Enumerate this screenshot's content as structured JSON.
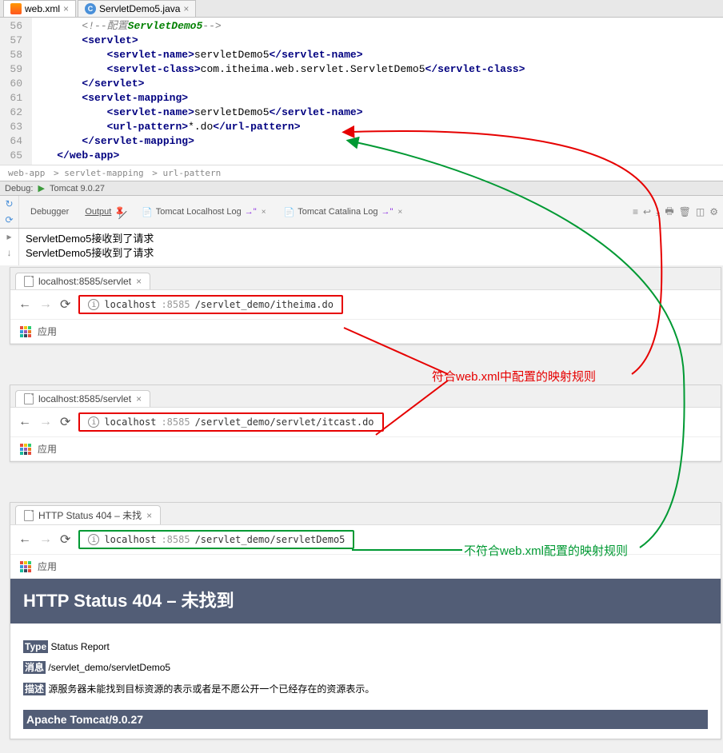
{
  "ide": {
    "tabs": [
      {
        "label": "web.xml",
        "active": true,
        "type": "xml"
      },
      {
        "label": "ServletDemo5.java",
        "active": false,
        "type": "java"
      }
    ],
    "lines": [
      "56",
      "57",
      "58",
      "59",
      "60",
      "61",
      "62",
      "63",
      "64",
      "65"
    ],
    "code": {
      "l56": {
        "indent": "        ",
        "open": "<!--",
        "body": "配置",
        "ital": "ServletDemo5",
        "close": "-->"
      },
      "l57": {
        "indent": "        ",
        "t1": "<",
        "t2": "servlet",
        "t3": ">"
      },
      "l58": {
        "indent": "            ",
        "t1": "<",
        "t2": "servlet-name",
        "t3": ">",
        "txt": "servletDemo5",
        "t4": "</",
        "t5": "servlet-name",
        "t6": ">"
      },
      "l59": {
        "indent": "            ",
        "t1": "<",
        "t2": "servlet-class",
        "t3": ">",
        "txt": "com.itheima.web.servlet.ServletDemo5",
        "t4": "</",
        "t5": "servlet-class",
        "t6": ">"
      },
      "l60": {
        "indent": "        ",
        "t1": "</",
        "t2": "servlet",
        "t3": ">"
      },
      "l61": {
        "indent": "        ",
        "t1": "<",
        "t2": "servlet-mapping",
        "t3": ">"
      },
      "l62": {
        "indent": "            ",
        "t1": "<",
        "t2": "servlet-name",
        "t3": ">",
        "txt": "servletDemo5",
        "t4": "</",
        "t5": "servlet-name",
        "t6": ">"
      },
      "l63": {
        "indent": "            ",
        "t1": "<",
        "t2": "url-pattern",
        "t3": ">",
        "txt": "*.do",
        "t4": "</",
        "t5": "url-pattern",
        "t6": ">"
      },
      "l64": {
        "indent": "        ",
        "t1": "</",
        "t2": "servlet-mapping",
        "t3": ">"
      },
      "l65": {
        "indent": "    ",
        "t1": "</",
        "t2": "web-app",
        "t3": ">"
      }
    },
    "breadcrumb": [
      "web-app",
      "servlet-mapping",
      "url-pattern"
    ]
  },
  "debug": {
    "label": "Debug:",
    "config": "Tomcat 9.0.27"
  },
  "toolbar": {
    "tabs": {
      "debugger": "Debugger",
      "output": "Output",
      "tomcat_local": "Tomcat Localhost Log",
      "tomcat_catalina": "Tomcat Catalina Log"
    }
  },
  "output": {
    "line1": "ServletDemo5接收到了请求",
    "line2": "ServletDemo5接收到了请求"
  },
  "browsers": [
    {
      "tab": "localhost:8585/servlet",
      "host": "localhost",
      "port": ":8585",
      "path": "/servlet_demo/itheima.do",
      "box_class": "red-border",
      "apps": "应用"
    },
    {
      "tab": "localhost:8585/servlet",
      "host": "localhost",
      "port": ":8585",
      "path": "/servlet_demo/servlet/itcast.do",
      "box_class": "red-border",
      "apps": "应用"
    },
    {
      "tab": "HTTP Status 404 – 未找",
      "host": "localhost",
      "port": ":8585",
      "path": "/servlet_demo/servletDemo5",
      "box_class": "green-border",
      "apps": "应用"
    }
  ],
  "error": {
    "title": "HTTP Status 404 – 未找到",
    "type_label": "Type",
    "type_text": "Status Report",
    "msg_label": "消息",
    "msg_text": "/servlet_demo/servletDemo5",
    "desc_label": "描述",
    "desc_text": "源服务器未能找到目标资源的表示或者是不愿公开一个已经存在的资源表示。",
    "footer": "Apache Tomcat/9.0.27"
  },
  "annotations": {
    "red": "符合web.xml中配置的映射规则",
    "green": "不符合web.xml配置的映射规则"
  }
}
